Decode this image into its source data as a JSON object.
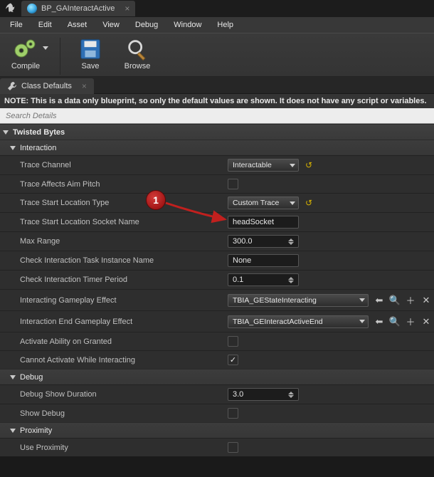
{
  "tab": {
    "title": "BP_GAInteractActive"
  },
  "menu": [
    "File",
    "Edit",
    "Asset",
    "View",
    "Debug",
    "Window",
    "Help"
  ],
  "toolbar": {
    "compile": "Compile",
    "save": "Save",
    "browse": "Browse"
  },
  "panel_tab": "Class Defaults",
  "note": "NOTE: This is a data only blueprint, so only the default values are shown.   It does not have any script or variables.",
  "search_placeholder": "Search Details",
  "sections": {
    "top": "Twisted Bytes",
    "interaction": "Interaction",
    "debug": "Debug",
    "proximity": "Proximity"
  },
  "props": {
    "trace_channel": {
      "label": "Trace Channel",
      "value": "Interactable",
      "reset": true
    },
    "trace_affects_aim_pitch": {
      "label": "Trace Affects Aim Pitch",
      "checked": false
    },
    "trace_start_location_type": {
      "label": "Trace Start Location Type",
      "value": "Custom Trace",
      "reset": true
    },
    "trace_start_socket": {
      "label": "Trace Start Location Socket Name",
      "value": "headSocket"
    },
    "max_range": {
      "label": "Max Range",
      "value": "300.0"
    },
    "check_task_instance": {
      "label": "Check Interaction Task Instance Name",
      "value": "None"
    },
    "check_timer_period": {
      "label": "Check Interaction Timer Period",
      "value": "0.1"
    },
    "interacting_effect": {
      "label": "Interacting Gameplay Effect",
      "value": "TBIA_GEStateInteracting"
    },
    "interaction_end_effect": {
      "label": "Interaction End Gameplay Effect",
      "value": "TBIA_GEInteractActiveEnd"
    },
    "activate_on_granted": {
      "label": "Activate Ability on Granted",
      "checked": false
    },
    "cannot_activate_while": {
      "label": "Cannot Activate While Interacting",
      "checked": true
    },
    "debug_show_duration": {
      "label": "Debug Show Duration",
      "value": "3.0"
    },
    "show_debug": {
      "label": "Show Debug",
      "checked": false
    },
    "use_proximity": {
      "label": "Use Proximity",
      "checked": false
    }
  },
  "callout": "1"
}
